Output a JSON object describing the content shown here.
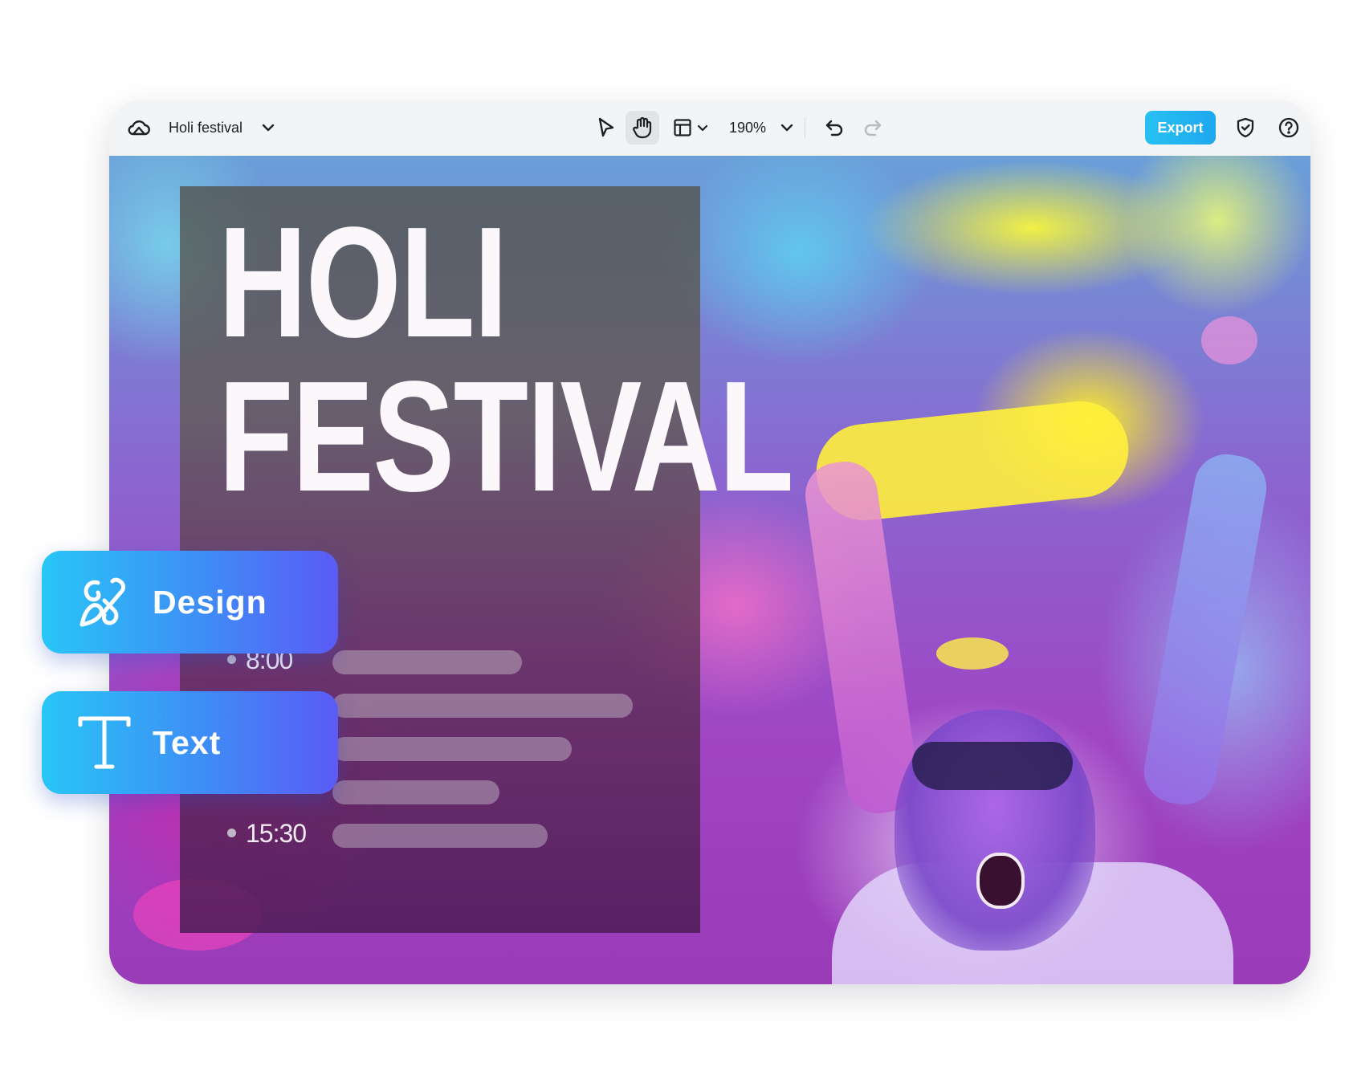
{
  "toolbar": {
    "doc_title": "Holi festival",
    "zoom": "190%",
    "export_label": "Export",
    "icons": [
      "cloud-icon",
      "chevron-down-icon",
      "select-pointer-icon",
      "hand-icon",
      "layout-icon",
      "undo-icon",
      "redo-icon",
      "shield-check-icon",
      "help-icon"
    ]
  },
  "poster": {
    "headline": [
      "HOLI",
      "FESTIVAL"
    ],
    "times": [
      "8:00",
      "15:30"
    ]
  },
  "cards": {
    "design_label": "Design",
    "text_label": "Text"
  },
  "colors": {
    "accent": "#27c1f3",
    "card_gradient_start": "#28c6f6",
    "card_gradient_end": "#5b5bf6"
  }
}
